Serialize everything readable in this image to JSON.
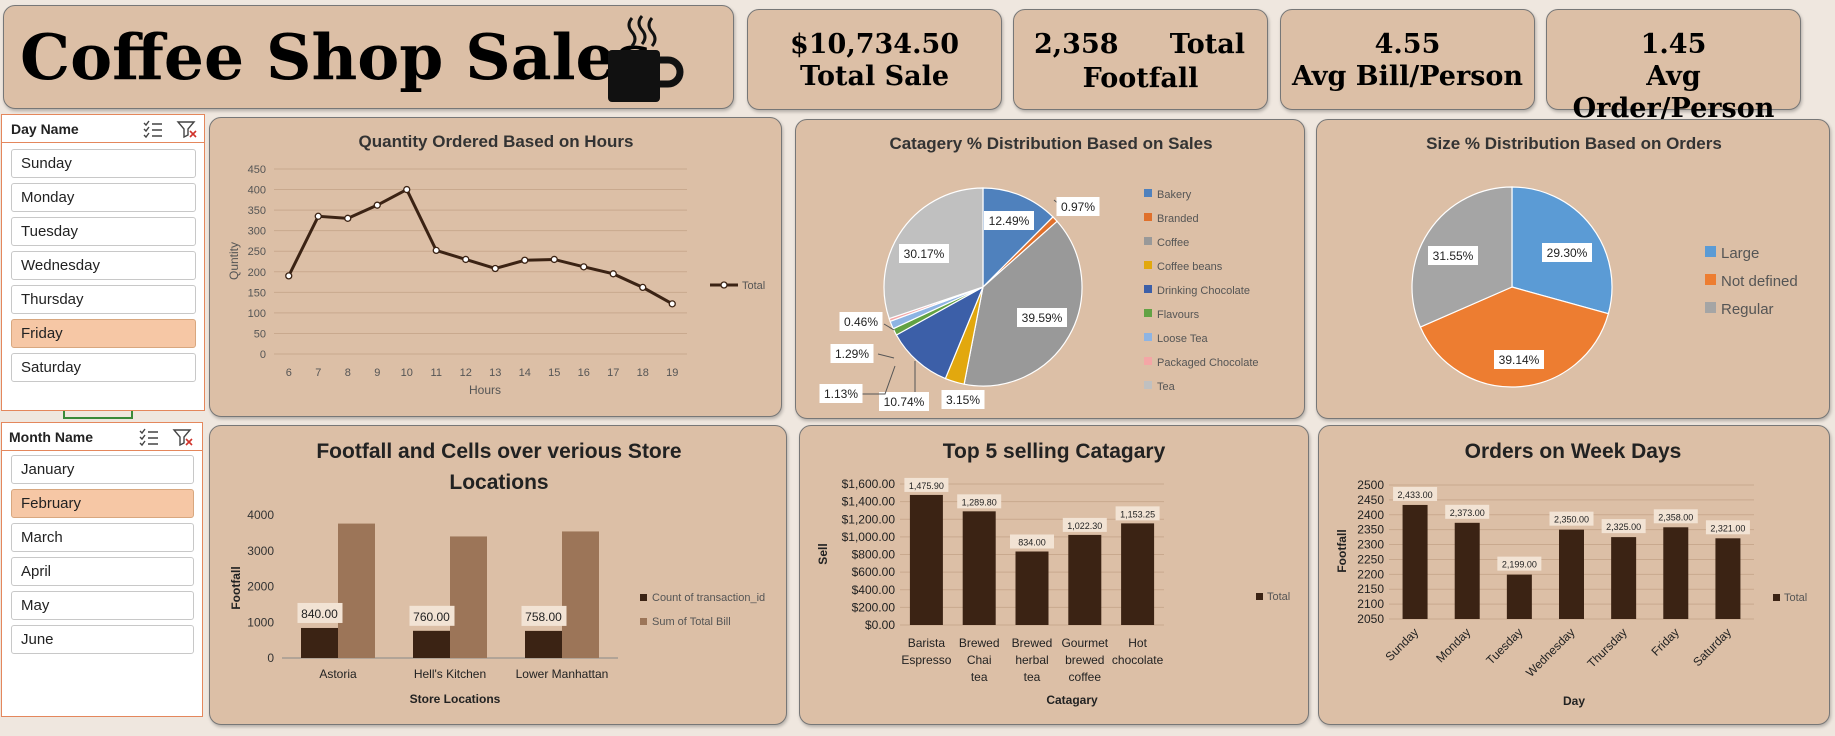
{
  "header": {
    "title": "Coffee Shop Sales",
    "icon": "coffee-mug-icon"
  },
  "kpis": {
    "total_sale": {
      "value": "$10,734.50",
      "label": "Total Sale"
    },
    "footfall": {
      "value": "2,358",
      "label_top": "Total",
      "label_bottom": "Footfall"
    },
    "avg_bill": {
      "value": "4.55",
      "label": "Avg Bill/Person"
    },
    "avg_order": {
      "value": "1.45",
      "label": "Avg Order/Person"
    }
  },
  "day_slicer": {
    "title": "Day Name",
    "items": [
      "Sunday",
      "Monday",
      "Tuesday",
      "Wednesday",
      "Thursday",
      "Friday",
      "Saturday"
    ],
    "selected": "Friday"
  },
  "month_slicer": {
    "title": "Month Name",
    "items": [
      "January",
      "February",
      "March",
      "April",
      "May",
      "June"
    ],
    "selected": "February"
  },
  "colors": {
    "panel": "#dcbfa6",
    "dark_brown": "#3b2314",
    "light_brown": "#9c7558",
    "accent": "#e4875c"
  },
  "chart_data": [
    {
      "type": "line",
      "title": "Quantity Ordered Based on Hours",
      "xlabel": "Hours",
      "ylabel": "Quntity",
      "x": [
        6,
        7,
        8,
        9,
        10,
        11,
        12,
        13,
        14,
        15,
        16,
        17,
        18,
        19
      ],
      "series": [
        {
          "name": "Total",
          "values": [
            190,
            335,
            330,
            362,
            400,
            252,
            230,
            208,
            228,
            230,
            212,
            195,
            162,
            122
          ]
        }
      ],
      "ylim": [
        0,
        450
      ],
      "yticks": [
        0,
        50,
        100,
        150,
        200,
        250,
        300,
        350,
        400,
        450
      ],
      "grid": true,
      "legend": "right"
    },
    {
      "type": "pie",
      "title": "Catagery % Distribution Based on Sales",
      "categories": [
        "Bakery",
        "Branded",
        "Coffee",
        "Coffee beans",
        "Drinking Chocolate",
        "Flavours",
        "Loose Tea",
        "Packaged Chocolate",
        "Tea"
      ],
      "values": [
        12.49,
        0.97,
        39.59,
        3.15,
        10.74,
        1.13,
        1.29,
        0.46,
        30.17
      ],
      "labels": [
        "12.49%",
        "0.97%",
        "39.59%",
        "3.15%",
        "10.74%",
        "1.13%",
        "1.29%",
        "0.46%",
        "30.17%"
      ],
      "colors": [
        "#4f81bd",
        "#e0702b",
        "#999999",
        "#e2a80e",
        "#3c5fa8",
        "#62a244",
        "#8eb4e3",
        "#f4a6a6",
        "#c0c0c0"
      ],
      "legend": "right"
    },
    {
      "type": "pie",
      "title": "Size % Distribution Based on Orders",
      "categories": [
        "Large",
        "Not defined",
        "Regular"
      ],
      "values": [
        29.3,
        39.14,
        31.55
      ],
      "labels": [
        "29.30%",
        "39.14%",
        "31.55%"
      ],
      "colors": [
        "#5b9bd5",
        "#ed7d31",
        "#a5a5a5"
      ],
      "legend": "right"
    },
    {
      "type": "bar",
      "title": "Footfall and Cells over verious Store Locations",
      "xlabel": "Store Locations",
      "ylabel": "Footfall",
      "categories": [
        "Astoria",
        "Hell's Kitchen",
        "Lower Manhattan"
      ],
      "series": [
        {
          "name": "Count of transaction_id",
          "values": [
            840,
            760,
            758
          ],
          "labels": [
            "840.00",
            "760.00",
            "758.00"
          ]
        },
        {
          "name": "Sum of Total Bill",
          "values": [
            3760,
            3400,
            3540
          ]
        }
      ],
      "ylim": [
        0,
        4000
      ],
      "yticks": [
        0,
        1000,
        2000,
        3000,
        4000
      ],
      "legend": "right"
    },
    {
      "type": "bar",
      "title": "Top 5 selling Catagary",
      "xlabel": "Catagary",
      "ylabel": "Sell",
      "categories": [
        "Barista Espresso",
        "Brewed Chai tea",
        "Brewed herbal tea",
        "Gourmet brewed coffee",
        "Hot chocolate"
      ],
      "series": [
        {
          "name": "Total",
          "values": [
            1475.9,
            1289.8,
            834.0,
            1022.3,
            1153.25
          ],
          "labels": [
            "1,475.90",
            "1,289.80",
            "834.00",
            "1,022.30",
            "1,153.25"
          ]
        }
      ],
      "ylim": [
        0,
        1600
      ],
      "yticks": [
        "$0.00",
        "$200.00",
        "$400.00",
        "$600.00",
        "$800.00",
        "$1,000.00",
        "$1,200.00",
        "$1,400.00",
        "$1,600.00"
      ],
      "legend": "right"
    },
    {
      "type": "bar",
      "title": "Orders on Week Days",
      "xlabel": "Day",
      "ylabel": "Footfall",
      "categories": [
        "Sunday",
        "Monday",
        "Tuesday",
        "Wednesday",
        "Thursday",
        "Friday",
        "Saturday"
      ],
      "series": [
        {
          "name": "Total",
          "values": [
            2433,
            2373,
            2199,
            2350,
            2325,
            2358,
            2321
          ],
          "labels": [
            "2,433.00",
            "2,373.00",
            "2,199.00",
            "2,350.00",
            "2,325.00",
            "2,358.00",
            "2,321.00"
          ]
        }
      ],
      "ylim": [
        2050,
        2500
      ],
      "yticks": [
        2050,
        2100,
        2150,
        2200,
        2250,
        2300,
        2350,
        2400,
        2450,
        2500
      ],
      "legend": "right"
    }
  ]
}
